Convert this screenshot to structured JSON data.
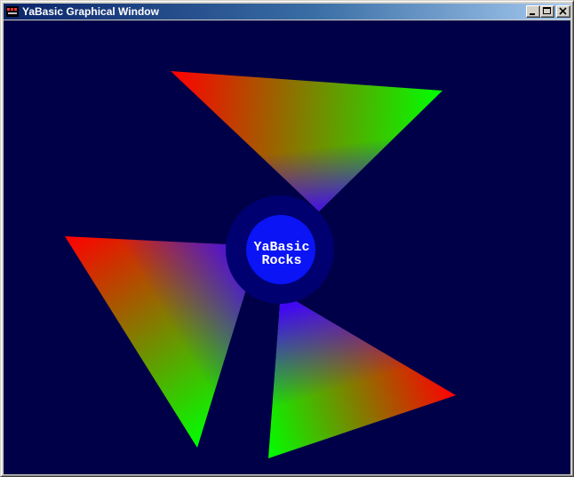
{
  "window": {
    "title": "YaBasic Graphical Window",
    "app_icon": "yabasic-app-icon",
    "buttons": [
      {
        "name": "minimize-button",
        "icon": "minimize-icon"
      },
      {
        "name": "maximize-button",
        "icon": "maximize-icon"
      },
      {
        "name": "close-button",
        "icon": "close-icon"
      }
    ]
  },
  "canvas": {
    "background_color": "#000048",
    "ring_color": "#000070",
    "center_circle_color": "#0a14f5",
    "text_color": "#ffffff",
    "center_text_line1": "YaBasic",
    "center_text_line2": "Rocks",
    "triangle_colors": [
      "#ff0000",
      "#00ff00",
      "#4000ff"
    ]
  }
}
